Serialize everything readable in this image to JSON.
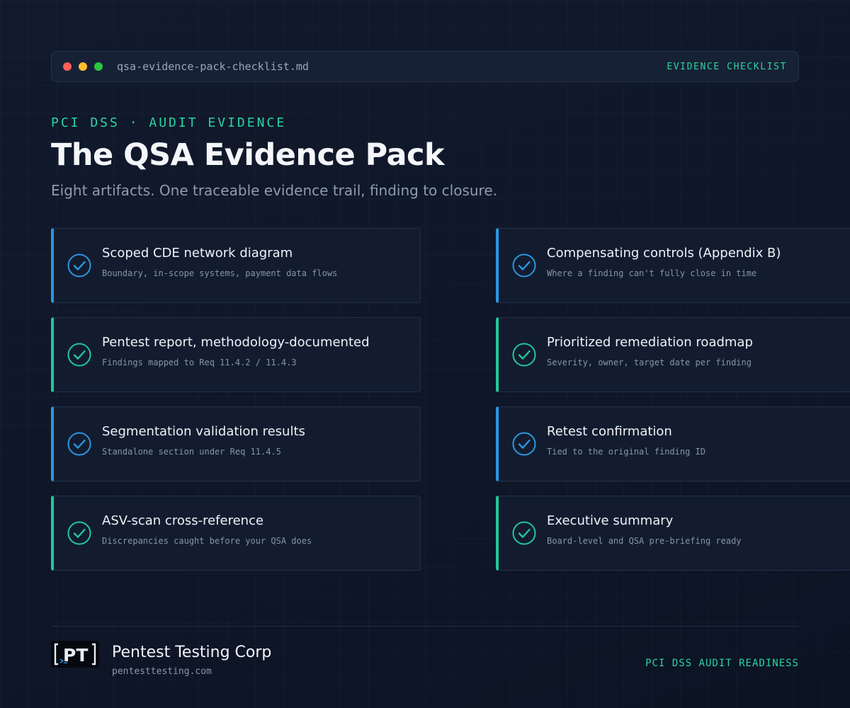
{
  "window": {
    "filename": "qsa-evidence-pack-checklist.md",
    "tag": "EVIDENCE CHECKLIST"
  },
  "header": {
    "eyebrow": "PCI DSS · AUDIT EVIDENCE",
    "title": "The QSA Evidence Pack",
    "subtitle": "Eight artifacts. One traceable evidence trail, finding to closure."
  },
  "colors": {
    "accent_blue": "#2b97e0",
    "accent_teal": "#24c79a",
    "background": "#0f1728"
  },
  "items": [
    {
      "title": "Scoped CDE network diagram",
      "desc": "Boundary, in-scope systems, payment data flows",
      "accent": "blue"
    },
    {
      "title": "Compensating controls (Appendix B)",
      "desc": "Where a finding can't fully close in time",
      "accent": "blue"
    },
    {
      "title": "Pentest report, methodology-documented",
      "desc": "Findings mapped to Req 11.4.2 / 11.4.3",
      "accent": "teal"
    },
    {
      "title": "Prioritized remediation roadmap",
      "desc": "Severity, owner, target date per finding",
      "accent": "teal"
    },
    {
      "title": "Segmentation validation results",
      "desc": "Standalone section under Req 11.4.5",
      "accent": "blue"
    },
    {
      "title": "Retest confirmation",
      "desc": "Tied to the original finding ID",
      "accent": "blue"
    },
    {
      "title": "ASV-scan cross-reference",
      "desc": "Discrepancies caught before your QSA does",
      "accent": "teal"
    },
    {
      "title": "Executive summary",
      "desc": "Board-level and QSA pre-briefing ready",
      "accent": "teal"
    }
  ],
  "footer": {
    "logo_text": "PT",
    "brand_name": "Pentest Testing Corp",
    "brand_url": "pentesttesting.com",
    "tag": "PCI DSS AUDIT READINESS"
  }
}
